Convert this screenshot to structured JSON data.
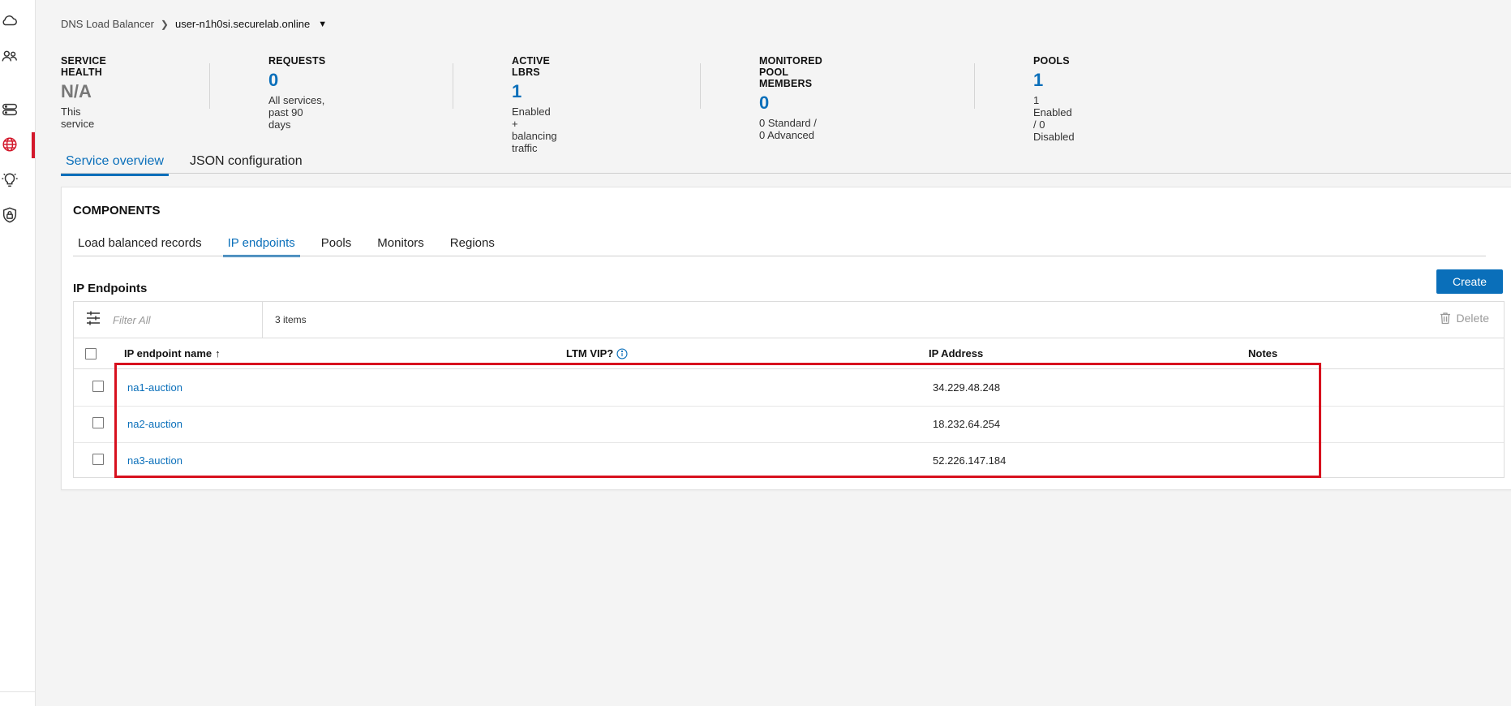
{
  "breadcrumb": {
    "root": "DNS Load Balancer",
    "current": "user-n1h0si.securelab.online"
  },
  "stats": [
    {
      "label": "SERVICE HEALTH",
      "value": "N/A",
      "sub": "This service"
    },
    {
      "label": "REQUESTS",
      "value": "0",
      "sub": "All services, past 90 days"
    },
    {
      "label": "ACTIVE LBRS",
      "value": "1",
      "sub": "Enabled + balancing traffic"
    },
    {
      "label": "MONITORED POOL MEMBERS",
      "value": "0",
      "sub": "0 Standard / 0 Advanced"
    },
    {
      "label": "POOLS",
      "value": "1",
      "sub": "1 Enabled / 0 Disabled"
    }
  ],
  "main_tabs": [
    {
      "label": "Service overview"
    },
    {
      "label": "JSON configuration"
    }
  ],
  "components": {
    "title": "COMPONENTS",
    "tabs": [
      {
        "label": "Load balanced records"
      },
      {
        "label": "IP endpoints"
      },
      {
        "label": "Pools"
      },
      {
        "label": "Monitors"
      },
      {
        "label": "Regions"
      }
    ]
  },
  "ip_endpoints": {
    "title": "IP Endpoints",
    "create_label": "Create",
    "filter_placeholder": "Filter All",
    "items_count": "3 items",
    "delete_label": "Delete",
    "columns": {
      "name": "IP endpoint name",
      "ltm": "LTM VIP?",
      "ip": "IP Address",
      "notes": "Notes"
    },
    "rows": [
      {
        "name": "na1-auction",
        "ip": "34.229.48.248"
      },
      {
        "name": "na2-auction",
        "ip": "18.232.64.254"
      },
      {
        "name": "na3-auction",
        "ip": "52.226.147.184"
      }
    ]
  },
  "colors": {
    "accent": "#0a6fba",
    "highlight": "#d7101e",
    "nav_active": "#d3182b"
  },
  "sidebar_icons": [
    "cloud-icon",
    "users-icon",
    "storage-icon",
    "globe-icon",
    "lightbulb-icon",
    "shield-lock-icon"
  ]
}
